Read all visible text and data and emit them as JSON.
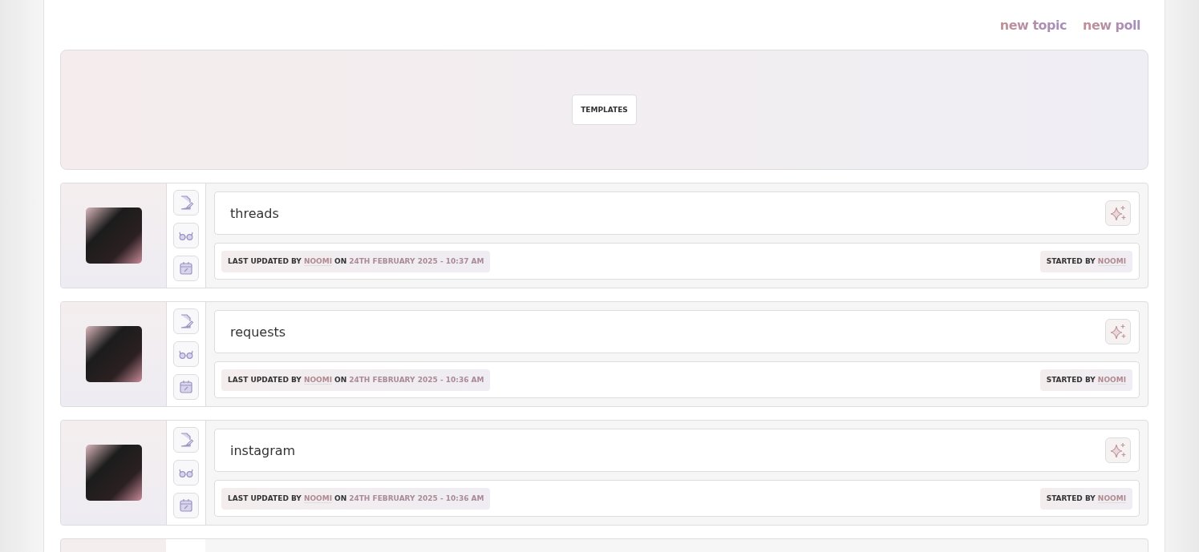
{
  "header_links": [
    "new topic",
    "new poll"
  ],
  "banner": {
    "button": "TEMPLATES"
  },
  "topics": [
    {
      "title": "threads",
      "last_updated_label": "LAST UPDATED BY",
      "last_user": "NOOMI",
      "on_label": "ON",
      "date": "24TH FEBRUARY 2025 - 10:37 AM",
      "started_label": "STARTED BY",
      "starter": "NOOMI"
    },
    {
      "title": "requests",
      "last_updated_label": "LAST UPDATED BY",
      "last_user": "NOOMI",
      "on_label": "ON",
      "date": "24TH FEBRUARY 2025 - 10:36 AM",
      "started_label": "STARTED BY",
      "starter": "NOOMI"
    },
    {
      "title": "instagram",
      "last_updated_label": "LAST UPDATED BY",
      "last_user": "NOOMI",
      "on_label": "ON",
      "date": "24TH FEBRUARY 2025 - 10:36 AM",
      "started_label": "STARTED BY",
      "starter": "NOOMI"
    }
  ]
}
